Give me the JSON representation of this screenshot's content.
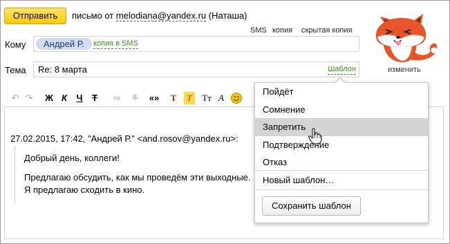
{
  "compose": {
    "send_label": "Отправить",
    "from_prefix": "письмо от",
    "from_email": "melodiana@yandex.ru",
    "from_name": "(Наташа)",
    "sms_label": "SMS",
    "copy_label": "копия",
    "bcc_label": "скрытая копия",
    "to_label": "Кому",
    "recipient": "Андрей Р.",
    "sms_copy_label": "копия в SMS",
    "subject_label": "Тема",
    "subject_value": "Re: 8 марта",
    "template_link": "Шаблон",
    "avatar_change_label": "изменить"
  },
  "toolbar": {
    "icons": [
      "undo-icon",
      "redo-icon",
      "bold-icon",
      "italic-icon",
      "underline-icon",
      "strikethrough-icon",
      "link-icon",
      "unlink-icon",
      "quote-icon",
      "text-color-icon",
      "background-color-icon",
      "font-size-icon",
      "font-family-icon",
      "smiley-icon"
    ],
    "bold": "Ж",
    "italic": "К",
    "underline": "Ч",
    "strike": "Т",
    "quote": "«»",
    "text_color": "Т",
    "bg_color": "Т",
    "font_size": "Тт",
    "font_family": "A"
  },
  "body": {
    "quote_header": "27.02.2015, 17:42, \"Андрей Р.\" <and.rosov@yandex.ru>:",
    "lines": [
      "Добрый день, коллеги!",
      "Предлагаю обсудить, как мы проведём эти выходные.",
      "Я предлагаю сходить в кино."
    ]
  },
  "template_menu": {
    "items": [
      "Пойдёт",
      "Сомнение",
      "Запретить",
      "Подтверждение",
      "Отказ"
    ],
    "highlighted_index": 2,
    "new_template": "Новый шаблон…",
    "save_template": "Сохранить шаблон"
  },
  "colors": {
    "send_button": "#ffcc00",
    "link_green": "#3b8f1c",
    "chip_bg": "#cfdcf3",
    "highlight": "#d4d4d4"
  }
}
